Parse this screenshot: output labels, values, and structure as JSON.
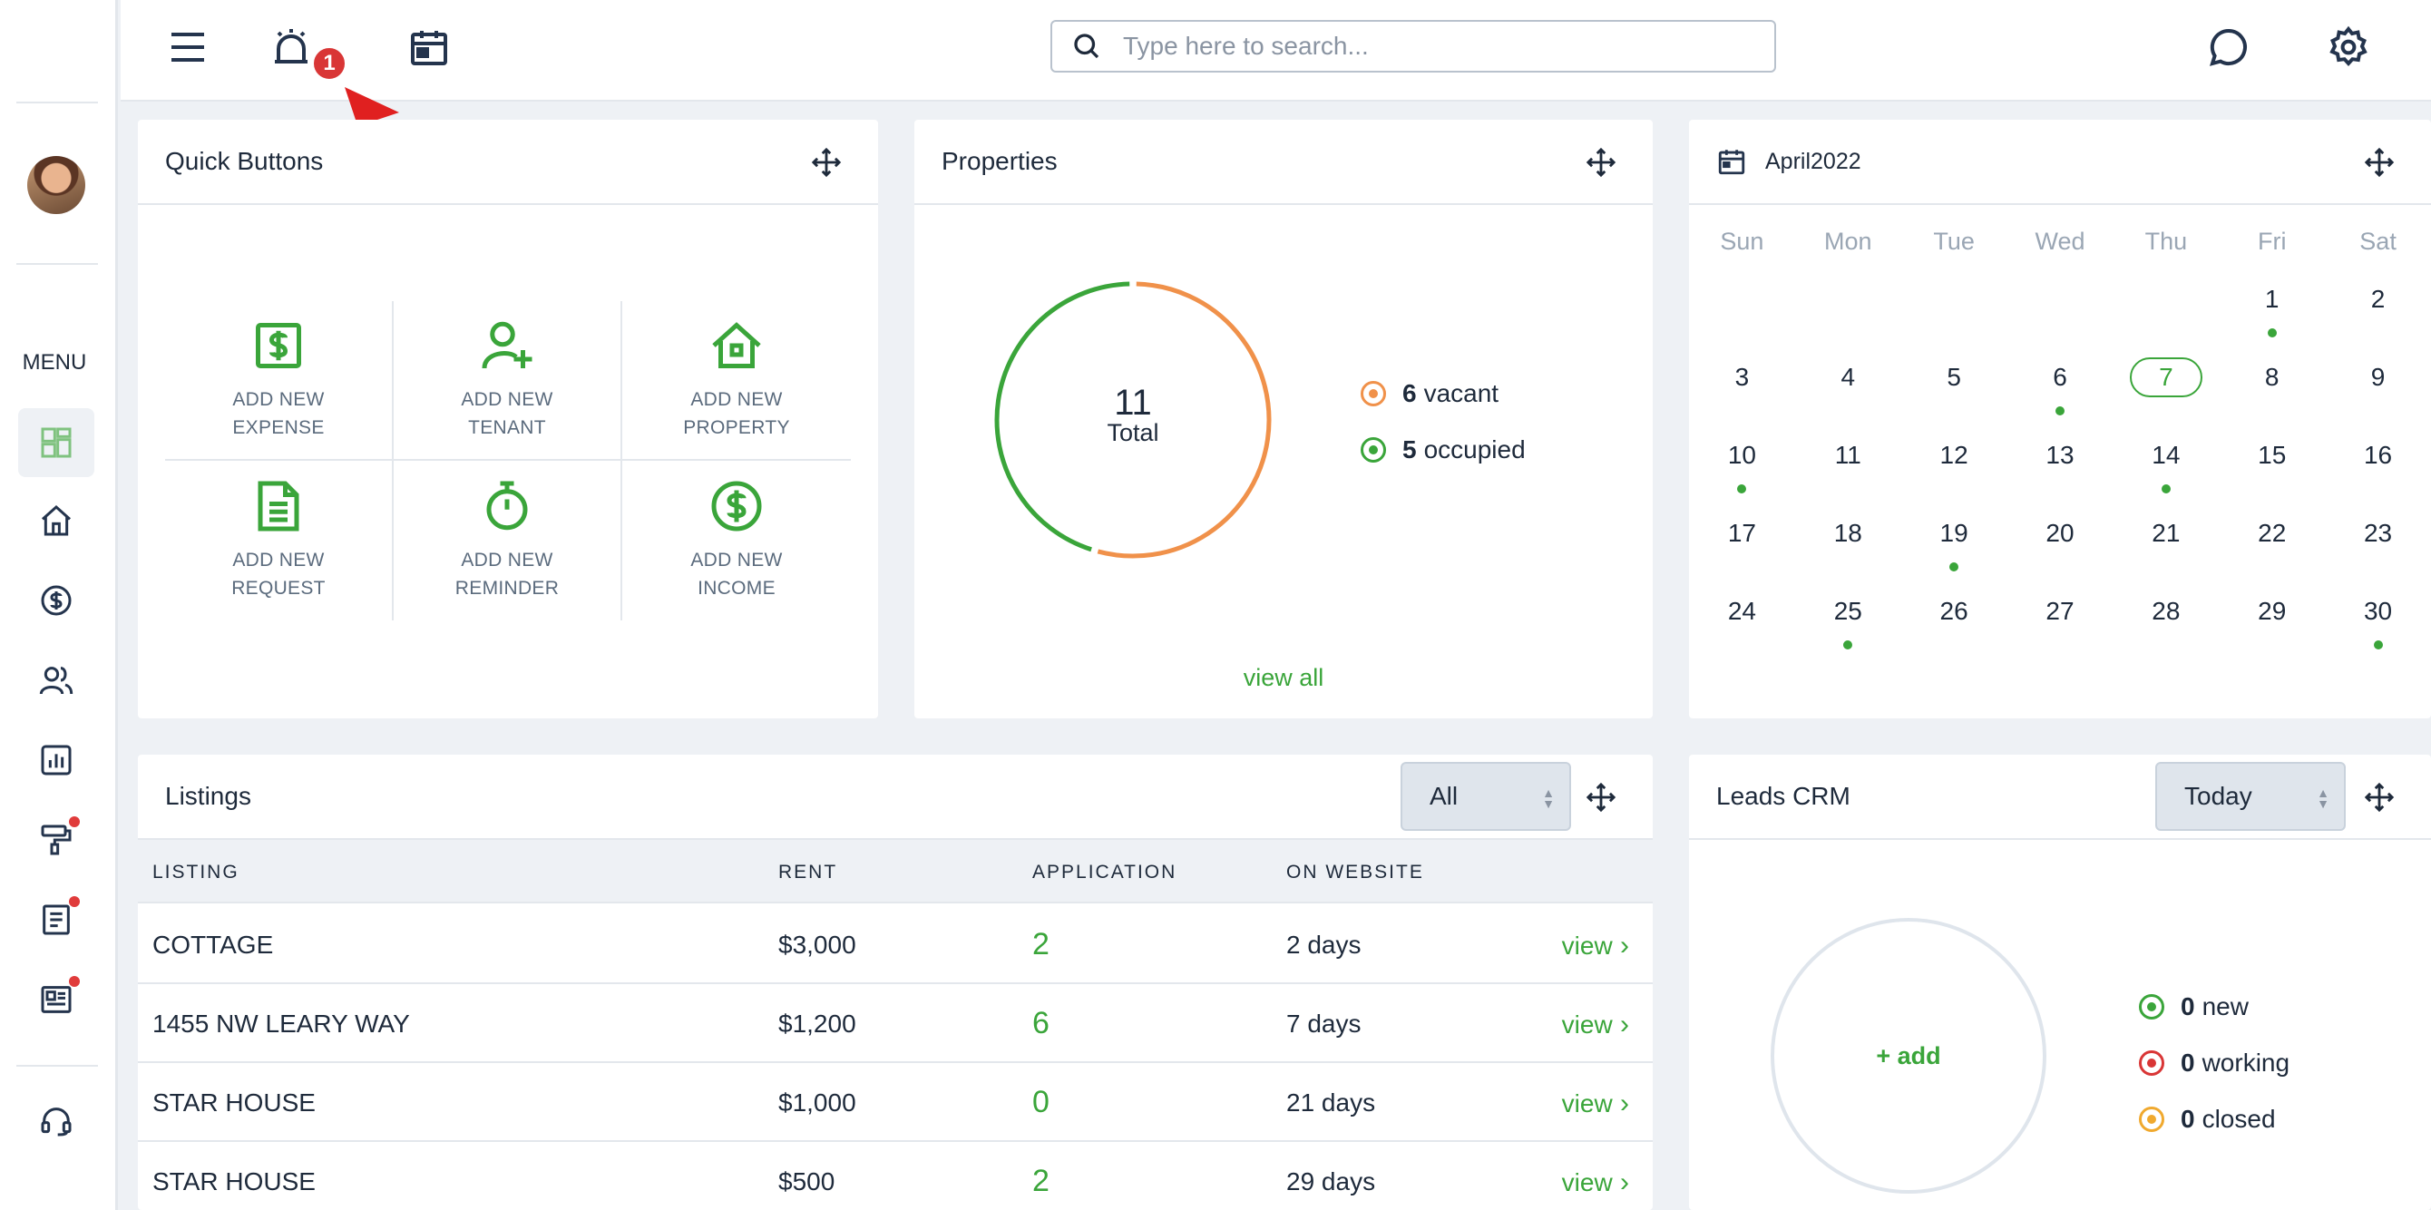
{
  "colors": {
    "accent": "#3aa53a",
    "orange": "#f0914a",
    "red": "#d93636",
    "yellow": "#f0a92e"
  },
  "sidebar": {
    "menu_label": "MENU",
    "items": [
      {
        "icon": "dashboard-icon",
        "active": true
      },
      {
        "icon": "home-icon"
      },
      {
        "icon": "dollar-circle-icon"
      },
      {
        "icon": "users-icon"
      },
      {
        "icon": "bar-chart-icon"
      },
      {
        "icon": "paint-roller-icon",
        "dot": true
      },
      {
        "icon": "document-icon",
        "dot": true
      },
      {
        "icon": "newspaper-icon",
        "dot": true
      },
      {
        "icon": "headset-icon"
      }
    ]
  },
  "topbar": {
    "notification_count": "1",
    "search_placeholder": "Type here to search..."
  },
  "quick_buttons": {
    "title": "Quick Buttons",
    "buttons": [
      {
        "icon": "expense-icon",
        "label": "ADD NEW\nEXPENSE"
      },
      {
        "icon": "add-tenant-icon",
        "label": "ADD NEW\nTENANT"
      },
      {
        "icon": "property-icon",
        "label": "ADD NEW\nPROPERTY"
      },
      {
        "icon": "request-icon",
        "label": "ADD NEW\nREQUEST"
      },
      {
        "icon": "stopwatch-icon",
        "label": "ADD NEW\nREMINDER"
      },
      {
        "icon": "income-icon",
        "label": "ADD NEW\nINCOME"
      }
    ]
  },
  "properties": {
    "title": "Properties",
    "total": "11",
    "total_label": "Total",
    "vacant_count": "6",
    "vacant_label": "vacant",
    "occupied_count": "5",
    "occupied_label": "occupied",
    "view_all": "view all",
    "vacant_value": 6,
    "occupied_value": 5
  },
  "calendar": {
    "title": "April2022",
    "weekdays": [
      "Sun",
      "Mon",
      "Tue",
      "Wed",
      "Thu",
      "Fri",
      "Sat"
    ],
    "weeks": [
      [
        {
          "d": ""
        },
        {
          "d": ""
        },
        {
          "d": ""
        },
        {
          "d": ""
        },
        {
          "d": ""
        },
        {
          "d": "1",
          "dot": true
        },
        {
          "d": "2"
        }
      ],
      [
        {
          "d": "3"
        },
        {
          "d": "4"
        },
        {
          "d": "5"
        },
        {
          "d": "6",
          "dot": true
        },
        {
          "d": "7",
          "today": true
        },
        {
          "d": "8"
        },
        {
          "d": "9"
        }
      ],
      [
        {
          "d": "10",
          "dot": true
        },
        {
          "d": "11"
        },
        {
          "d": "12"
        },
        {
          "d": "13"
        },
        {
          "d": "14",
          "dot": true
        },
        {
          "d": "15"
        },
        {
          "d": "16"
        }
      ],
      [
        {
          "d": "17"
        },
        {
          "d": "18"
        },
        {
          "d": "19",
          "dot": true
        },
        {
          "d": "20"
        },
        {
          "d": "21"
        },
        {
          "d": "22"
        },
        {
          "d": "23"
        }
      ],
      [
        {
          "d": "24"
        },
        {
          "d": "25",
          "dot": true
        },
        {
          "d": "26"
        },
        {
          "d": "27"
        },
        {
          "d": "28"
        },
        {
          "d": "29"
        },
        {
          "d": "30",
          "dot": true
        }
      ]
    ]
  },
  "listings": {
    "title": "Listings",
    "filter": "All",
    "columns": [
      "LISTING",
      "RENT",
      "APPLICATION",
      "ON WEBSITE"
    ],
    "rows": [
      {
        "listing": "COTTAGE",
        "rent": "$3,000",
        "application": "2",
        "on_website": "2 days",
        "action": "view"
      },
      {
        "listing": "1455 NW LEARY WAY",
        "rent": "$1,200",
        "application": "6",
        "on_website": "7 days",
        "action": "view"
      },
      {
        "listing": "STAR HOUSE",
        "rent": "$1,000",
        "application": "0",
        "on_website": "21 days",
        "action": "view"
      },
      {
        "listing": "STAR HOUSE",
        "rent": "$500",
        "application": "2",
        "on_website": "29 days",
        "action": "view"
      }
    ]
  },
  "leads": {
    "title": "Leads CRM",
    "filter": "Today",
    "add_label": "+ add",
    "new_count": "0",
    "new_label": "new",
    "working_count": "0",
    "working_label": "working",
    "closed_count": "0",
    "closed_label": "closed"
  }
}
